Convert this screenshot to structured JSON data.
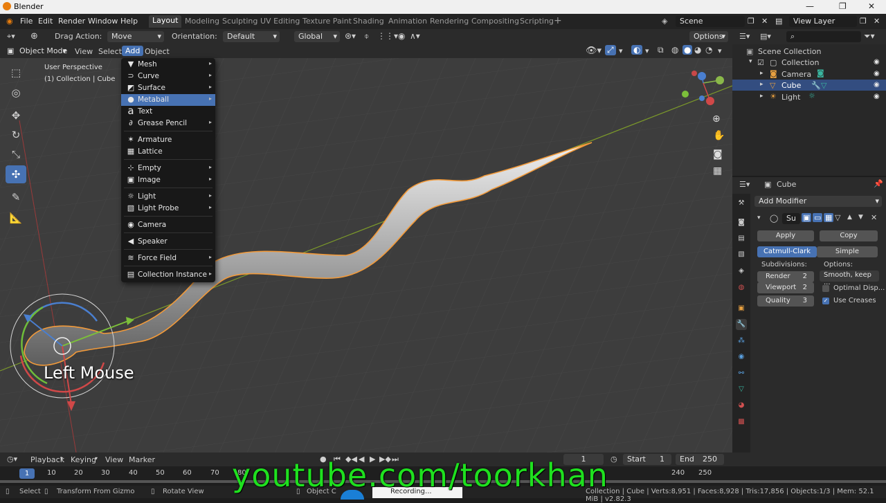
{
  "window": {
    "title": "Blender"
  },
  "menu": {
    "file": "File",
    "edit": "Edit",
    "render": "Render",
    "window": "Window",
    "help": "Help"
  },
  "workspaces": [
    "Layout",
    "Modeling",
    "Sculpting",
    "UV Editing",
    "Texture Paint",
    "Shading",
    "Animation",
    "Rendering",
    "Compositing",
    "Scripting"
  ],
  "scene": {
    "name": "Scene",
    "view_layer": "View Layer"
  },
  "tool_header": {
    "drag_action_label": "Drag Action:",
    "drag_action_value": "Move",
    "orientation_label": "Orientation:",
    "orientation_value": "Default",
    "transform_orientation": "Global",
    "options": "Options"
  },
  "viewport_header": {
    "mode": "Object Mode",
    "view": "View",
    "select": "Select",
    "add": "Add",
    "object": "Object"
  },
  "viewport": {
    "perspective": "User Perspective",
    "collection_info": "(1) Collection | Cube",
    "overlay_text": "Left Mouse"
  },
  "add_menu": {
    "items": [
      {
        "label": "Mesh",
        "icon": "mesh-icon",
        "glyph": "▼",
        "sub": "▸"
      },
      {
        "label": "Curve",
        "icon": "curve-icon",
        "glyph": "⊃",
        "sub": "▸"
      },
      {
        "label": "Surface",
        "icon": "surface-icon",
        "glyph": "◩",
        "sub": "▸"
      },
      {
        "label": "Metaball",
        "icon": "metaball-icon",
        "glyph": "●",
        "sub": "▸"
      },
      {
        "label": "Text",
        "icon": "text-icon",
        "glyph": "a",
        "sub": ""
      },
      {
        "label": "Grease Pencil",
        "icon": "grease-pencil-icon",
        "glyph": "∂",
        "sub": "▸"
      },
      {
        "label": "Armature",
        "icon": "armature-icon",
        "glyph": "✶",
        "sub": ""
      },
      {
        "label": "Lattice",
        "icon": "lattice-icon",
        "glyph": "▦",
        "sub": ""
      },
      {
        "label": "Empty",
        "icon": "empty-icon",
        "glyph": "⊹",
        "sub": "▸"
      },
      {
        "label": "Image",
        "icon": "image-icon",
        "glyph": "▣",
        "sub": "▸"
      },
      {
        "label": "Light",
        "icon": "light-icon",
        "glyph": "☼",
        "sub": "▸"
      },
      {
        "label": "Light Probe",
        "icon": "light-probe-icon",
        "glyph": "▧",
        "sub": "▸"
      },
      {
        "label": "Camera",
        "icon": "camera-icon",
        "glyph": "◉",
        "sub": ""
      },
      {
        "label": "Speaker",
        "icon": "speaker-icon",
        "glyph": "◀",
        "sub": ""
      },
      {
        "label": "Force Field",
        "icon": "force-field-icon",
        "glyph": "≋",
        "sub": "▸"
      },
      {
        "label": "Collection Instance",
        "icon": "collection-instance-icon",
        "glyph": "▤",
        "sub": "▸"
      }
    ]
  },
  "outliner": {
    "root": "Scene Collection",
    "collection": "Collection",
    "camera": "Camera",
    "cube": "Cube",
    "light": "Light"
  },
  "properties": {
    "object_name": "Cube",
    "add_modifier": "Add Modifier",
    "modifier_short": "Su",
    "apply": "Apply",
    "copy": "Copy",
    "catmull": "Catmull-Clark",
    "simple": "Simple",
    "subdivisions_label": "Subdivisions:",
    "options_label": "Options:",
    "render_label": "Render",
    "render_value": "2",
    "viewport_label": "Viewport",
    "viewport_value": "2",
    "quality_label": "Quality",
    "quality_value": "3",
    "smooth": "Smooth, keep ...",
    "optimal": "Optimal Disp...",
    "use_creases": "Use Creases"
  },
  "timeline": {
    "playback": "Playback",
    "keying": "Keying",
    "view": "View",
    "marker": "Marker",
    "current": "1",
    "start_label": "Start",
    "start": "1",
    "end_label": "End",
    "end": "250"
  },
  "frames": [
    "1",
    "10",
    "20",
    "30",
    "40",
    "50",
    "60",
    "70",
    "80",
    "240",
    "250"
  ],
  "status": {
    "select": "Select",
    "transform": "Transform From Gizmo",
    "rotate": "Rotate View",
    "object": "Object C",
    "recording": "Recording...",
    "stats": "Collection | Cube | Verts:8,951 | Faces:8,928 | Tris:17,856 | Objects:1/3 | Mem: 52.1 MiB | v2.82.3"
  },
  "watermark": "youtube.com/toorkhan",
  "colors": {
    "accent": "#4772b3",
    "selection": "#e8a040",
    "watermark": "#1fe01f"
  }
}
